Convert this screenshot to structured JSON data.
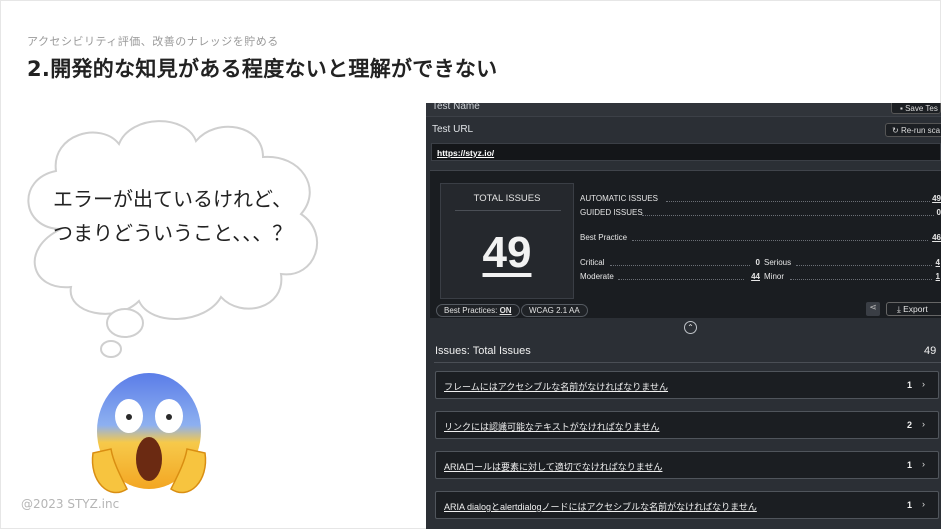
{
  "slide": {
    "eyebrow": "アクセシビリティ評価、改善のナレッジを貯める",
    "heading": "2.開発的な知見がある程度ないと理解ができない",
    "footer": "@2023 STYZ.inc",
    "bubble_line1": "エラーが出ているけれど、",
    "bubble_line2": "つまりどういうこと、、、？"
  },
  "panel": {
    "test_name_label": "Test Name",
    "save_label": "Save Tes",
    "test_url_label": "Test URL",
    "rerun_label": "Re-run sca",
    "url_value": "https://styz.io/",
    "total_issues_label": "TOTAL ISSUES",
    "total_issues_value": "49",
    "stats": {
      "automatic_label": "AUTOMATIC ISSUES",
      "automatic_value": "49",
      "guided_label": "GUIDED ISSUES",
      "guided_value": "0",
      "best_practice_label": "Best Practice",
      "best_practice_value": "46",
      "critical_label": "Critical",
      "critical_value": "0",
      "serious_label": "Serious",
      "serious_value": "4",
      "moderate_label": "Moderate",
      "moderate_value": "44",
      "minor_label": "Minor",
      "minor_value": "1"
    },
    "best_practices_prefix": "Best Practices: ",
    "best_practices_state": "ON",
    "wcag_label": "WCAG 2.1 AA",
    "export_label": "Export",
    "issues_title": "Issues: Total Issues",
    "issues_count": "49",
    "issues": [
      {
        "title": "フレームにはアクセシブルな名前がなければなりません",
        "count": "1"
      },
      {
        "title": "リンクには認識可能なテキストがなければなりません",
        "count": "2"
      },
      {
        "title": "ARIAロールは要素に対して適切でなければなりません",
        "count": "1"
      },
      {
        "title": "ARIA dialogとalertdialogノードにはアクセシブルな名前がなければなりません",
        "count": "1"
      }
    ]
  },
  "colors": {
    "panel_bg": "#2b2f35",
    "summary_bg": "#1a1d21",
    "text_light": "#f1f1f1"
  },
  "icons": {
    "save": "save-icon",
    "rerun": "refresh-icon",
    "share": "share-icon",
    "export": "download-icon",
    "collapse": "chevron-up-icon",
    "row_arrow": "chevron-right-icon",
    "emoji": "screaming-face-emoji"
  }
}
